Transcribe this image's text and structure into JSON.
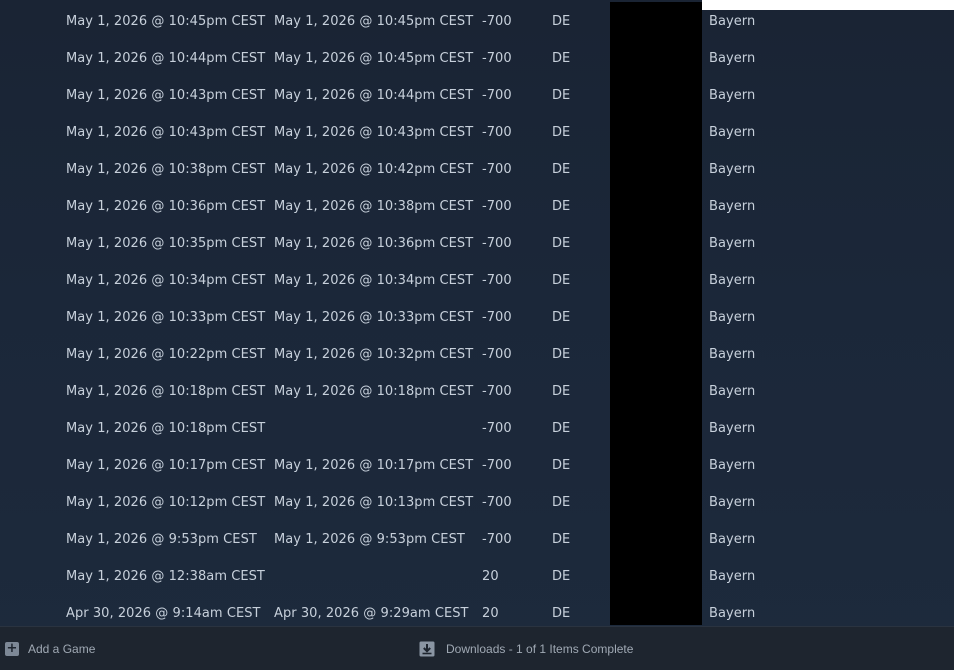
{
  "history": {
    "rows": [
      {
        "start": "May 1, 2026 @ 10:45pm CEST",
        "end": "May 1, 2026 @ 10:45pm CEST",
        "score": "-700",
        "country": "DE",
        "region": "Bayern"
      },
      {
        "start": "May 1, 2026 @ 10:44pm CEST",
        "end": "May 1, 2026 @ 10:45pm CEST",
        "score": "-700",
        "country": "DE",
        "region": "Bayern"
      },
      {
        "start": "May 1, 2026 @ 10:43pm CEST",
        "end": "May 1, 2026 @ 10:44pm CEST",
        "score": "-700",
        "country": "DE",
        "region": "Bayern"
      },
      {
        "start": "May 1, 2026 @ 10:43pm CEST",
        "end": "May 1, 2026 @ 10:43pm CEST",
        "score": "-700",
        "country": "DE",
        "region": "Bayern"
      },
      {
        "start": "May 1, 2026 @ 10:38pm CEST",
        "end": "May 1, 2026 @ 10:42pm CEST",
        "score": "-700",
        "country": "DE",
        "region": "Bayern"
      },
      {
        "start": "May 1, 2026 @ 10:36pm CEST",
        "end": "May 1, 2026 @ 10:38pm CEST",
        "score": "-700",
        "country": "DE",
        "region": "Bayern"
      },
      {
        "start": "May 1, 2026 @ 10:35pm CEST",
        "end": "May 1, 2026 @ 10:36pm CEST",
        "score": "-700",
        "country": "DE",
        "region": "Bayern"
      },
      {
        "start": "May 1, 2026 @ 10:34pm CEST",
        "end": "May 1, 2026 @ 10:34pm CEST",
        "score": "-700",
        "country": "DE",
        "region": "Bayern"
      },
      {
        "start": "May 1, 2026 @ 10:33pm CEST",
        "end": "May 1, 2026 @ 10:33pm CEST",
        "score": "-700",
        "country": "DE",
        "region": "Bayern"
      },
      {
        "start": "May 1, 2026 @ 10:22pm CEST",
        "end": "May 1, 2026 @ 10:32pm CEST",
        "score": "-700",
        "country": "DE",
        "region": "Bayern"
      },
      {
        "start": "May 1, 2026 @ 10:18pm CEST",
        "end": "May 1, 2026 @ 10:18pm CEST",
        "score": "-700",
        "country": "DE",
        "region": "Bayern"
      },
      {
        "start": "May 1, 2026 @ 10:18pm CEST",
        "end": "",
        "score": "-700",
        "country": "DE",
        "region": "Bayern"
      },
      {
        "start": "May 1, 2026 @ 10:17pm CEST",
        "end": "May 1, 2026 @ 10:17pm CEST",
        "score": "-700",
        "country": "DE",
        "region": "Bayern"
      },
      {
        "start": "May 1, 2026 @ 10:12pm CEST",
        "end": "May 1, 2026 @ 10:13pm CEST",
        "score": "-700",
        "country": "DE",
        "region": "Bayern"
      },
      {
        "start": "May 1, 2026 @ 9:53pm CEST",
        "end": "May 1, 2026 @ 9:53pm CEST",
        "score": "-700",
        "country": "DE",
        "region": "Bayern"
      },
      {
        "start": "May 1, 2026 @ 12:38am CEST",
        "end": "",
        "score": "20",
        "country": "DE",
        "region": "Bayern"
      },
      {
        "start": "Apr 30, 2026 @ 9:14am CEST",
        "end": "Apr 30, 2026 @ 9:29am CEST",
        "score": "20",
        "country": "DE",
        "region": "Bayern"
      }
    ]
  },
  "bottom_bar": {
    "add_game_icon": "plus-icon",
    "add_game_label": "Add a Game",
    "downloads_icon": "download-icon",
    "downloads_label": "Downloads - 1 of 1 Items Complete"
  },
  "colors": {
    "background": "#1b2739",
    "text": "#c7d0db",
    "bottom_bar": "#1e252f",
    "redaction": "#000000"
  }
}
